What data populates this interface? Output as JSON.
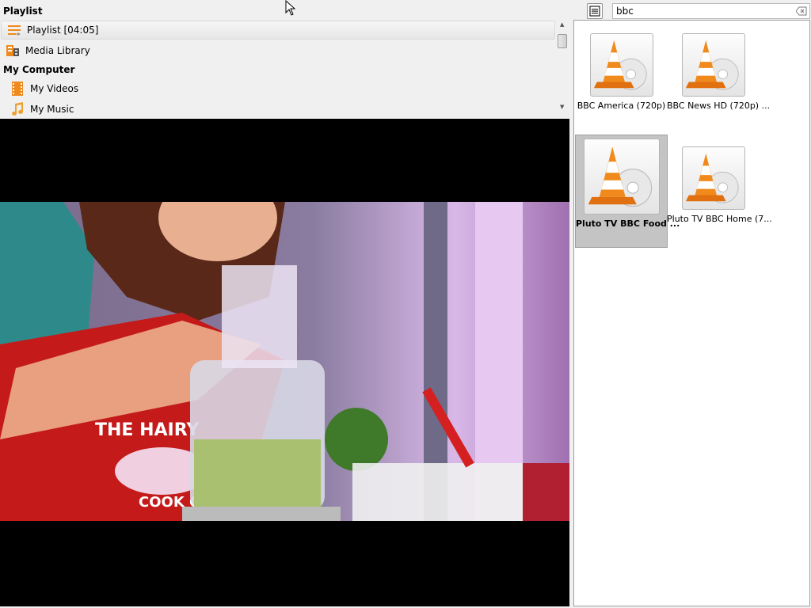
{
  "playlist": {
    "header": "Playlist",
    "items": [
      {
        "label": "Playlist [04:05]",
        "icon": "playlist-icon",
        "selected": true
      },
      {
        "label": "Media Library",
        "icon": "media-library-icon",
        "selected": false
      }
    ],
    "category": "My Computer",
    "computer_items": [
      {
        "label": "My Videos",
        "icon": "film-icon"
      },
      {
        "label": "My Music",
        "icon": "music-note-icon"
      }
    ]
  },
  "search": {
    "value": "bbc",
    "placeholder": ""
  },
  "results": [
    {
      "label": "BBC America (720p)",
      "icon": "vlc-cone-disc-icon",
      "selected": false
    },
    {
      "label": "BBC News HD (720p) ...",
      "icon": "vlc-cone-disc-icon",
      "selected": false
    },
    {
      "label": "Pluto TV BBC Food ...",
      "icon": "vlc-cone-disc-icon",
      "selected": true
    },
    {
      "label": "Pluto TV BBC Home (7...",
      "icon": "vlc-cone-disc-icon",
      "selected": false
    }
  ],
  "video": {
    "apron_text": "THE HAIRY BIKERS COOK OFF"
  },
  "colors": {
    "accent_orange": "#f08a1c",
    "selection_gray": "#c4c4c4",
    "video_bg": "#000000"
  }
}
